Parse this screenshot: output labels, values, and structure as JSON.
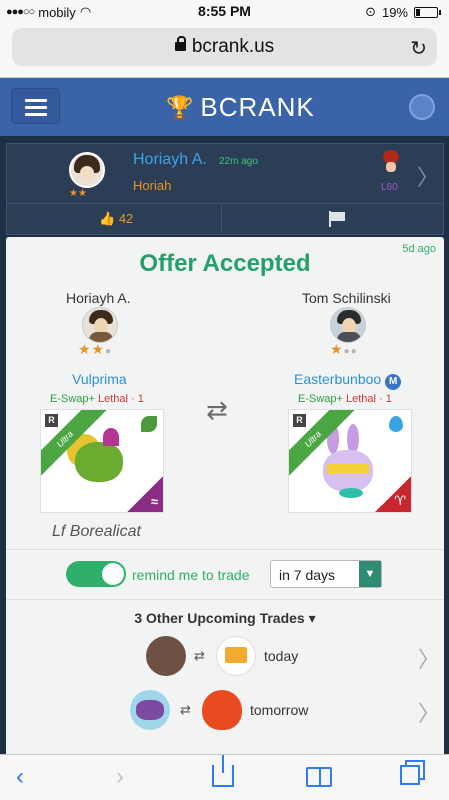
{
  "status": {
    "carrier": "mobily",
    "time": "8:55 PM",
    "battery": "19%"
  },
  "browser": {
    "url": "bcrank.us"
  },
  "header": {
    "brand": "BCRANK"
  },
  "post": {
    "user": "Horiayh A.",
    "time_ago": "22m ago",
    "subtitle": "Horiah",
    "stars": "★★",
    "level": "L60",
    "likes": "42"
  },
  "offer": {
    "time_ago": "5d ago",
    "title": "Offer Accepted",
    "left": {
      "trader": "Horiayh A.",
      "rating": 2,
      "monster": "Vulprima",
      "tag_swap": "E-Swap+",
      "tag_lethal": "Lethal · 1",
      "rarity_label": "R",
      "tier_label": "Ultra",
      "sign_symbol": "≈"
    },
    "right": {
      "trader": "Tom Schilinski",
      "rating": 1,
      "monster": "Easterbunboo",
      "monster_badge": "M",
      "tag_swap": "E-Swap+",
      "tag_lethal": "Lethal · 1",
      "rarity_label": "R",
      "tier_label": "Ultra",
      "sign_symbol": "♈"
    },
    "note": "Lf Borealicat",
    "remind_label": "remind me to trade",
    "remind_enabled": true,
    "remind_select_value": "in 7 days",
    "upcoming_title": "3 Other Upcoming Trades ▾",
    "upcoming": [
      {
        "when": "today"
      },
      {
        "when": "tomorrow"
      }
    ]
  }
}
